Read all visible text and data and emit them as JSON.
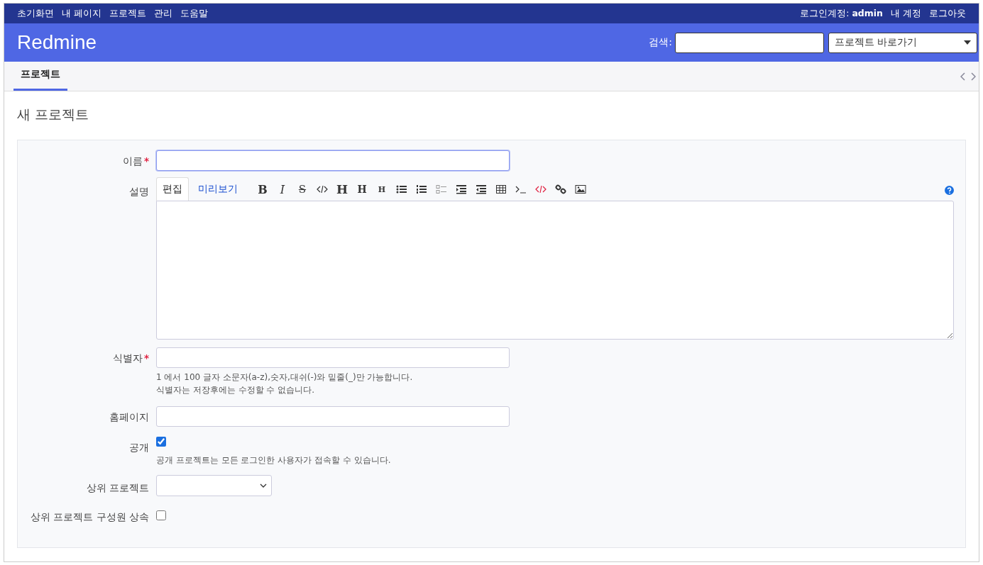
{
  "top_menu": [
    "초기화면",
    "내 페이지",
    "프로젝트",
    "관리",
    "도움말"
  ],
  "account": {
    "logged_in_label": "로그인계정:",
    "user": "admin",
    "links": [
      "내 계정",
      "로그아웃"
    ]
  },
  "header": {
    "title": "Redmine",
    "search_label": "검색:",
    "jump_placeholder": "프로젝트 바로가기"
  },
  "tabs": [
    {
      "label": "프로젝트",
      "selected": true
    }
  ],
  "page_title": "새 프로젝트",
  "form": {
    "name": {
      "label": "이름",
      "required_mark": "*"
    },
    "description": {
      "label": "설명",
      "tabs": [
        {
          "label": "편집",
          "selected": true
        },
        {
          "label": "미리보기",
          "selected": false
        }
      ],
      "toolbar": [
        {
          "kind": "bold",
          "label": "B"
        },
        {
          "kind": "italic",
          "label": "I"
        },
        {
          "kind": "strike",
          "label": "S"
        },
        {
          "kind": "code"
        },
        {
          "kind": "h1",
          "label": "H"
        },
        {
          "kind": "h2",
          "label": "H"
        },
        {
          "kind": "h3",
          "label": "H"
        },
        {
          "kind": "ul"
        },
        {
          "kind": "ol"
        },
        {
          "kind": "tasklist"
        },
        {
          "kind": "indent"
        },
        {
          "kind": "outdent"
        },
        {
          "kind": "table"
        },
        {
          "kind": "pre"
        },
        {
          "kind": "precode"
        },
        {
          "kind": "link"
        },
        {
          "kind": "image"
        }
      ]
    },
    "identifier": {
      "label": "식별자",
      "required_mark": "*",
      "hints": [
        "1 에서 100 글자 소문자(a-z),숫자,대쉬(-)와 밑줄(_)만 가능합니다.",
        "식별자는 저장후에는 수정할 수 없습니다."
      ]
    },
    "homepage": {
      "label": "홈페이지"
    },
    "public": {
      "label": "공개",
      "checked": true,
      "hint": "공개 프로젝트는 모든 로그인한 사용자가 접속할 수 있습니다."
    },
    "parent": {
      "label": "상위 프로젝트"
    },
    "inherit_members": {
      "label": "상위 프로젝트 구성원 상속",
      "checked": false
    }
  }
}
